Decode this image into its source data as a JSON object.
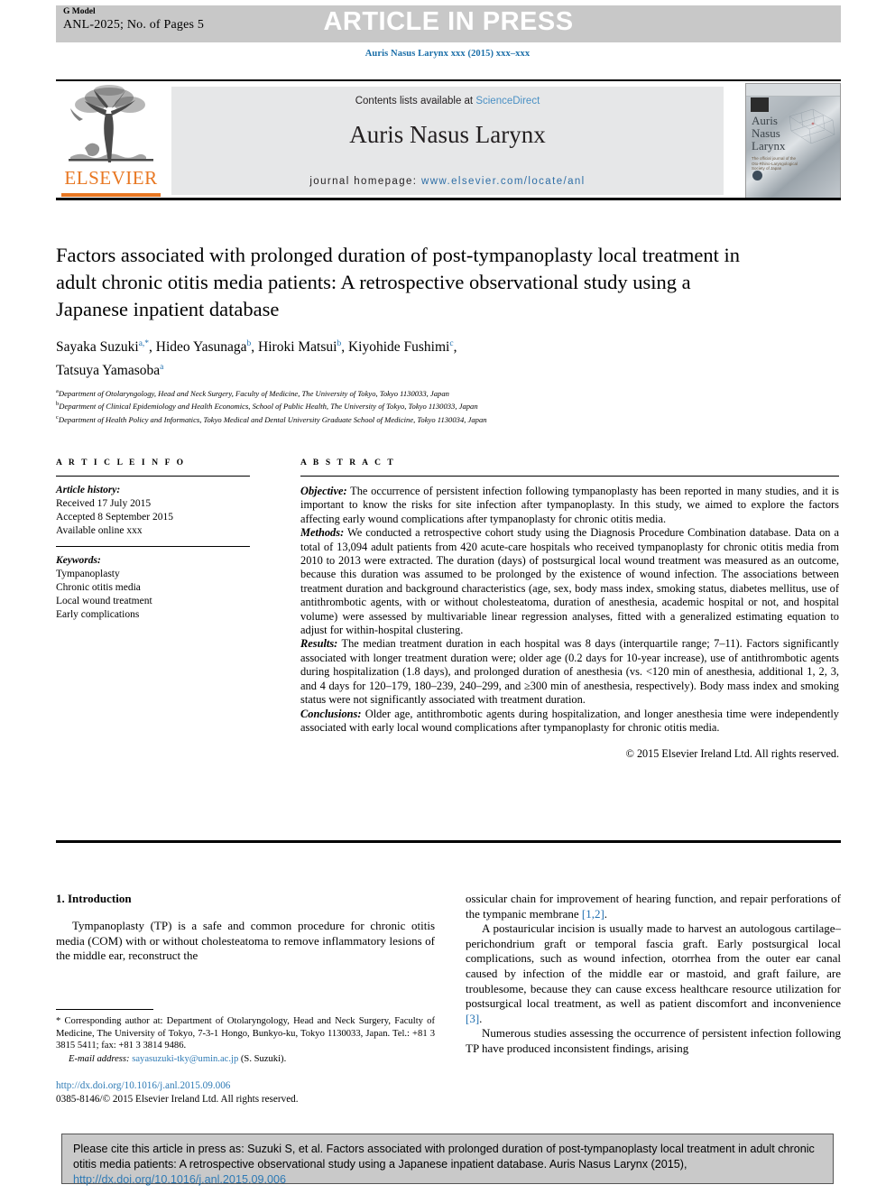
{
  "header": {
    "g_model_label": "G Model",
    "article_id": "ANL-2025; No. of Pages 5",
    "press_banner": "ARTICLE IN PRESS",
    "journal_citation": "Auris Nasus Larynx xxx (2015) xxx–xxx"
  },
  "masthead": {
    "contents_prefix": "Contents lists available at ",
    "sciencedirect": "ScienceDirect",
    "journal_title": "Auris Nasus Larynx",
    "homepage_label": "journal homepage: ",
    "homepage_url": "www.elsevier.com/locate/anl",
    "publisher_logo": "ELSEVIER",
    "cover_title": "Auris\nNasus\nLarynx",
    "cover_subtitle": "The official journal of the Oto-Rhino-Laryngological Society of Japan"
  },
  "article": {
    "title": "Factors associated with prolonged duration of post-tympanoplasty local treatment in adult chronic otitis media patients: A retrospective observational study using a Japanese inpatient database",
    "authors_line1_part1": "Sayaka Suzuki",
    "authors_line1_sup1": "a,*",
    "authors_line1_part2": ", Hideo Yasunaga",
    "authors_line1_sup2": "b",
    "authors_line1_part3": ", Hiroki Matsui",
    "authors_line1_sup3": "b",
    "authors_line1_part4": ", Kiyohide Fushimi",
    "authors_line1_sup4": "c",
    "authors_line1_part5": ",",
    "authors_line2_part1": "Tatsuya Yamasoba",
    "authors_line2_sup1": "a",
    "affiliations": [
      {
        "marker": "a",
        "text": "Department of Otolaryngology, Head and Neck Surgery, Faculty of Medicine, The University of Tokyo, Tokyo 1130033, Japan"
      },
      {
        "marker": "b",
        "text": "Department of Clinical Epidemiology and Health Economics, School of Public Health, The University of Tokyo, Tokyo 1130033, Japan"
      },
      {
        "marker": "c",
        "text": "Department of Health Policy and Informatics, Tokyo Medical and Dental University Graduate School of Medicine, Tokyo 1130034, Japan"
      }
    ]
  },
  "article_info": {
    "heading": "A R T I C L E  I N F O",
    "history_label": "Article history:",
    "received": "Received 17 July 2015",
    "accepted": "Accepted 8 September 2015",
    "available": "Available online xxx",
    "keywords_label": "Keywords:",
    "keywords": [
      "Tympanoplasty",
      "Chronic otitis media",
      "Local wound treatment",
      "Early complications"
    ]
  },
  "abstract": {
    "heading": "A B S T R A C T",
    "objective_label": "Objective:",
    "objective_text": " The occurrence of persistent infection following tympanoplasty has been reported in many studies, and it is important to know the risks for site infection after tympanoplasty. In this study, we aimed to explore the factors affecting early wound complications after tympanoplasty for chronic otitis media.",
    "methods_label": "Methods:",
    "methods_text": " We conducted a retrospective cohort study using the Diagnosis Procedure Combination database. Data on a total of 13,094 adult patients from 420  acute-care hospitals who received tympanoplasty for chronic otitis media from 2010 to 2013  were extracted. The duration (days) of postsurgical local wound treatment was measured as an outcome, because this duration was assumed to be prolonged by the existence of wound infection. The associations between treatment duration and background characteristics (age, sex, body mass index, smoking status, diabetes mellitus, use of antithrombotic agents, with or without cholesteatoma, duration of anesthesia, academic hospital or not, and hospital volume) were assessed by multivariable linear regression analyses, fitted with a generalized estimating equation to adjust for within-hospital clustering.",
    "results_label": "Results:",
    "results_text": "  The median treatment duration in each hospital was 8  days (interquartile range; 7–11). Factors significantly associated with longer treatment duration were; older age (0.2  days for 10-year increase), use of antithrombotic agents during hospitalization (1.8  days), and prolonged duration of anesthesia (vs. <120 min of anesthesia, additional 1, 2, 3, and 4  days for 120–179, 180–239, 240–299, and ≥300 min of anesthesia, respectively). Body mass index and smoking status were not significantly associated with treatment duration.",
    "conclusions_label": "Conclusions:",
    "conclusions_text": " Older age, antithrombotic agents during hospitalization, and longer anesthesia time were independently associated with early local wound complications after tympanoplasty for chronic otitis media.",
    "copyright": "© 2015 Elsevier Ireland Ltd. All rights reserved."
  },
  "introduction": {
    "heading": "1. Introduction",
    "left_para1": "Tympanoplasty (TP) is a safe and common procedure for chronic otitis media (COM) with or without cholesteatoma to remove inflammatory lesions of the middle ear, reconstruct the",
    "right_para1_cont": "ossicular chain for improvement of hearing function, and repair perforations of the tympanic membrane ",
    "right_para1_ref": "[1,2]",
    "right_para1_end": ".",
    "right_para2_a": "A postauricular incision is usually made to harvest an autologous cartilage–perichondrium graft or temporal fascia graft. Early postsurgical local complications, such as wound infection, otorrhea from the outer ear canal caused by infection of the middle ear or mastoid, and graft failure, are troublesome, because they can cause excess healthcare resource utilization for postsurgical local treatment, as well as patient discomfort and inconvenience ",
    "right_para2_ref": "[3]",
    "right_para2_end": ".",
    "right_para3": "Numerous studies assessing the occurrence of persistent infection following TP have produced inconsistent findings, arising"
  },
  "footnote": {
    "star": "*",
    "corresponding_text": " Corresponding author at: Department of Otolaryngology, Head and Neck Surgery, Faculty of Medicine, The University of Tokyo, 7-3-1 Hongo, Bunkyo-ku, Tokyo 1130033, Japan. Tel.: +81 3 3815 5411; fax: +81 3 3814 9486.",
    "email_label": "E-mail address:",
    "email": " sayasuzuki-tky@umin.ac.jp",
    "email_owner": " (S. Suzuki).",
    "doi_url": "http://dx.doi.org/10.1016/j.anl.2015.09.006",
    "issn_line": "0385-8146/© 2015 Elsevier Ireland Ltd. All rights reserved."
  },
  "citation_box": {
    "text": "Please cite this article in press as: Suzuki S, et al. Factors associated with prolonged duration of post-tympanoplasty local treatment in adult chronic otitis media patients: A retrospective observational study using a Japanese inpatient database. Auris Nasus Larynx (2015), ",
    "link": "http://dx.doi.org/10.1016/j.anl.2015.09.006"
  },
  "colors": {
    "link_blue": "#2e7ab5",
    "elsevier_orange": "#e87722",
    "banner_gray": "#c8c8c8",
    "masthead_gray": "#e6e7e8"
  }
}
